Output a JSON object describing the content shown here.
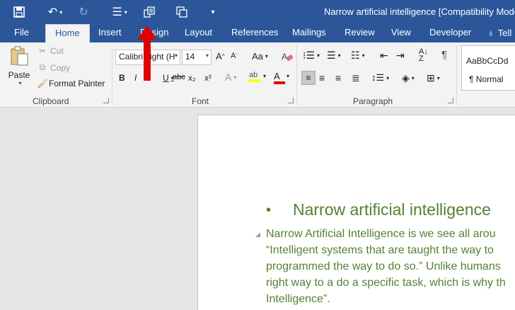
{
  "titlebar": {
    "document_title": "Narrow artificial intelligence [Compatibility Mode]",
    "qat_icons": [
      "save-icon",
      "undo-icon",
      "redo-icon",
      "numbering-icon",
      "compare-icon",
      "screen-icon",
      "customize-qat-icon"
    ]
  },
  "tabs": [
    {
      "label": "File"
    },
    {
      "label": "Home",
      "active": true
    },
    {
      "label": "Insert"
    },
    {
      "label": "Design"
    },
    {
      "label": "Layout"
    },
    {
      "label": "References"
    },
    {
      "label": "Mailings"
    },
    {
      "label": "Review"
    },
    {
      "label": "View"
    },
    {
      "label": "Developer"
    },
    {
      "label": "Tell"
    }
  ],
  "clipboard": {
    "paste": "Paste",
    "cut": "Cut",
    "copy": "Copy",
    "format_painter": "Format Painter",
    "label": "Clipboard"
  },
  "font": {
    "name": "Calibri Light (H",
    "size": "14",
    "label": "Font",
    "change_case": "Aa",
    "bold": "B",
    "italic": "I",
    "underline": "U",
    "strikethrough": "abc",
    "subscript": "x₂",
    "superscript": "x²",
    "font_color": "A",
    "highlight": "ab",
    "text_effects": "A"
  },
  "paragraph": {
    "label": "Paragraph"
  },
  "styles": {
    "sample": "AaBbCcDd",
    "name": "¶ Normal"
  },
  "document": {
    "heading": "Narrow artificial intelligence",
    "body_lines": [
      " Narrow Artificial Intelligence is we see all arou",
      "“Intelligent systems that are taught the way to",
      "programmed the way to do so.” Unlike humans",
      "right way to a do a specific task, which is why th",
      "Intelligence”."
    ]
  },
  "colors": {
    "title_bar": "#2b579a",
    "heading_text": "#538135",
    "annotation_arrow": "#e00000"
  }
}
